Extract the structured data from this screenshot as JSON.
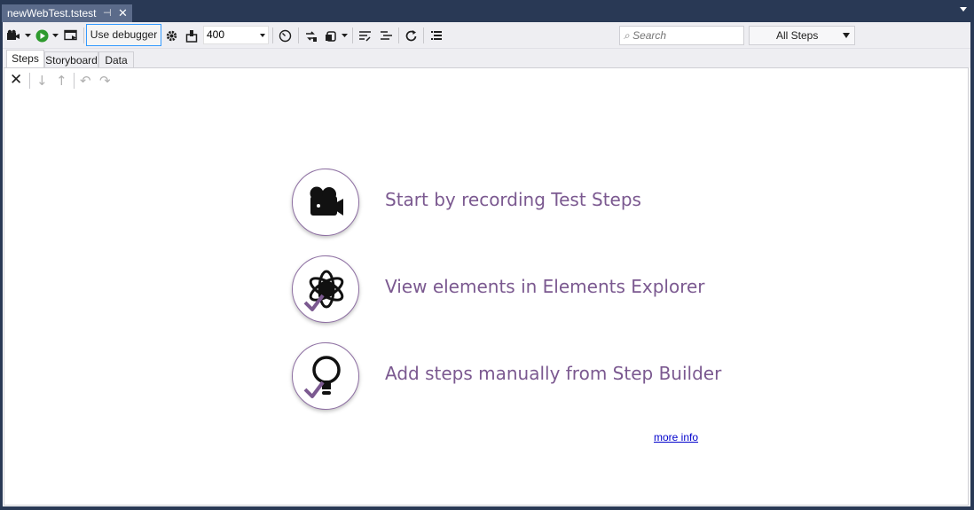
{
  "document": {
    "tab_title": "newWebTest.tstest",
    "pin_glyph": "⊣",
    "close_glyph": "✕"
  },
  "toolbar": {
    "debugger_label": "Use debugger",
    "delay_value": "400",
    "search_placeholder": "Search",
    "search_icon_glyph": "⌕",
    "filter_value": "All Steps"
  },
  "tabs": [
    {
      "label": "Steps",
      "active": true
    },
    {
      "label": "Storyboard",
      "active": false
    },
    {
      "label": "Data",
      "active": false
    }
  ],
  "edit_tools": {
    "delete_icon": "delete-icon",
    "move_down_icon": "arrow-down-icon",
    "move_up_icon": "arrow-up-icon",
    "undo_icon": "undo-icon",
    "redo_icon": "redo-icon"
  },
  "actions": [
    {
      "label": "Start by recording Test Steps",
      "icon": "video-camera-icon"
    },
    {
      "label": "View elements in Elements Explorer",
      "icon": "atom-icon"
    },
    {
      "label": "Add steps manually from Step Builder",
      "icon": "lightbulb-icon"
    }
  ],
  "more_info": "more info",
  "colors": {
    "chrome_bg": "#293955",
    "accent_purple": "#7b5990",
    "check_purple": "#8d6ea2",
    "toolbar_bg": "#eeeef2",
    "link_blue": "#0000cc"
  }
}
